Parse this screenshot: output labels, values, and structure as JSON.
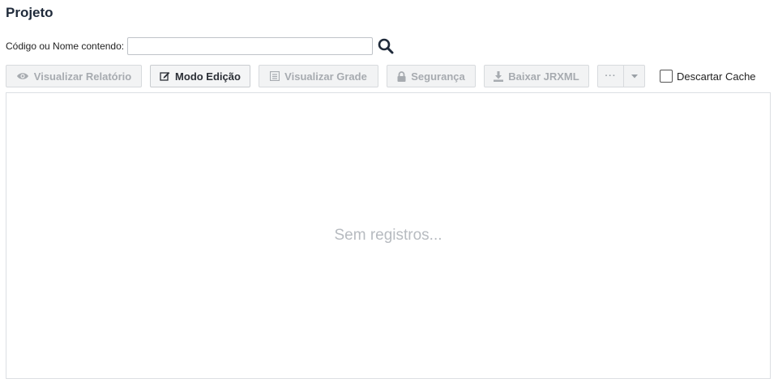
{
  "page": {
    "title": "Projeto"
  },
  "search": {
    "label": "Código ou Nome contendo:",
    "value": "",
    "placeholder": "",
    "button_icon": "search-icon"
  },
  "toolbar": {
    "buttons": [
      {
        "label": "Visualizar Relatório",
        "icon": "eye-icon",
        "enabled": false
      },
      {
        "label": "Modo Edição",
        "icon": "edit-icon",
        "enabled": true
      },
      {
        "label": "Visualizar Grade",
        "icon": "list-icon",
        "enabled": false
      },
      {
        "label": "Segurança",
        "icon": "lock-icon",
        "enabled": false
      },
      {
        "label": "Baixar JRXML",
        "icon": "download-icon",
        "enabled": false
      }
    ],
    "more_label": "···",
    "discard_cache": {
      "label": "Descartar Cache",
      "checked": false
    }
  },
  "grid": {
    "empty_text": "Sem registros..."
  }
}
